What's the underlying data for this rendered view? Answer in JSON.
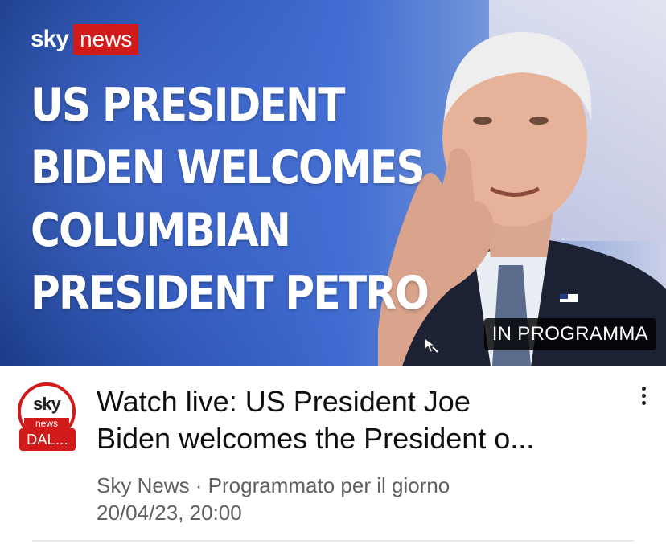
{
  "thumbnail": {
    "logo_sky": "sky",
    "logo_news": "news",
    "headline_lines": [
      "US PRESIDENT",
      "BIDEN WELCOMES",
      "COLUMBIAN",
      "PRESIDENT PETRO"
    ],
    "badge": "IN PROGRAMMA"
  },
  "channel": {
    "avatar_sky": "sky",
    "avatar_news": "news",
    "live_tag": "DAL..."
  },
  "video": {
    "title_line1": "Watch live: US President Joe",
    "title_line2": "Biden welcomes the President o...",
    "meta_line1": "Sky News · Programmato per il giorno",
    "meta_line2": "20/04/23, 20:00"
  },
  "icons": {
    "menu": "more-vert-icon",
    "cursor": "cursor-arrow-icon"
  },
  "colors": {
    "brand_red": "#d11a1a",
    "thumb_blue": "#2a52b3"
  }
}
